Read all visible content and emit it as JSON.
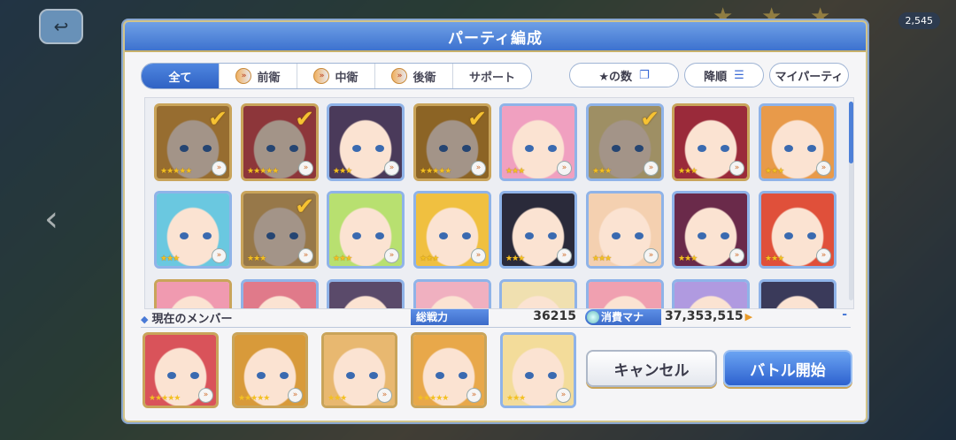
{
  "background": {
    "top_mana": "2,545",
    "back_icon": "back-arrow-icon"
  },
  "dialog": {
    "title": "パーティ編成"
  },
  "filter_tabs": [
    {
      "label": "全て",
      "active": true,
      "icon": false
    },
    {
      "label": "前衛",
      "active": false,
      "icon": true
    },
    {
      "label": "中衛",
      "active": false,
      "icon": true
    },
    {
      "label": "後衛",
      "active": false,
      "icon": true
    },
    {
      "label": "サポート",
      "active": false,
      "icon": false
    }
  ],
  "sort": {
    "star_label": "★の数",
    "order_label": "降順",
    "my_party_label": "マイパーティ"
  },
  "roster": [
    {
      "stars": "★★★★★",
      "selected": true,
      "frame": "gold",
      "hair": "#e8a84a"
    },
    {
      "stars": "★★★★★",
      "selected": true,
      "frame": "gold",
      "hair": "#d9535a"
    },
    {
      "stars": "★★★",
      "selected": false,
      "frame": "blue",
      "hair": "#4a3a5a"
    },
    {
      "stars": "★★★★★",
      "selected": true,
      "frame": "gold",
      "hair": "#d89a3a"
    },
    {
      "stars": "★★★",
      "selected": false,
      "frame": "blue",
      "hair": "#f0a0c0"
    },
    {
      "stars": "★★★",
      "selected": true,
      "frame": "blue",
      "hair": "#f3dc9a"
    },
    {
      "stars": "★★★",
      "selected": false,
      "frame": "gold",
      "hair": "#9a2a3a"
    },
    {
      "stars": "★★★",
      "selected": false,
      "frame": "blue",
      "hair": "#e89a4a"
    },
    {
      "stars": "★★★",
      "selected": false,
      "frame": "blue",
      "hair": "#6ac8e0"
    },
    {
      "stars": "★★★",
      "selected": true,
      "frame": "gold",
      "hair": "#e8b870"
    },
    {
      "stars": "★★★",
      "selected": false,
      "frame": "blue",
      "hair": "#b8e070"
    },
    {
      "stars": "★★★",
      "selected": false,
      "frame": "blue",
      "hair": "#f0c040"
    },
    {
      "stars": "★★★",
      "selected": false,
      "frame": "blue",
      "hair": "#2a2a3a"
    },
    {
      "stars": "★★★",
      "selected": false,
      "frame": "blue",
      "hair": "#f4d0b0"
    },
    {
      "stars": "★★★",
      "selected": false,
      "frame": "blue",
      "hair": "#6a2a4a"
    },
    {
      "stars": "★★★",
      "selected": false,
      "frame": "blue",
      "hair": "#e0503a"
    },
    {
      "stars": "",
      "selected": false,
      "frame": "gold",
      "hair": "#f09ab0"
    },
    {
      "stars": "",
      "selected": false,
      "frame": "blue",
      "hair": "#e07a8a"
    },
    {
      "stars": "",
      "selected": false,
      "frame": "blue",
      "hair": "#5a4a6a"
    },
    {
      "stars": "",
      "selected": false,
      "frame": "blue",
      "hair": "#f0b0c0"
    },
    {
      "stars": "",
      "selected": false,
      "frame": "blue",
      "hair": "#f0e0b0"
    },
    {
      "stars": "",
      "selected": false,
      "frame": "blue",
      "hair": "#f0a0b0"
    },
    {
      "stars": "",
      "selected": false,
      "frame": "blue",
      "hair": "#b09ae0"
    },
    {
      "stars": "",
      "selected": false,
      "frame": "blue",
      "hair": "#3a3a5a"
    }
  ],
  "party": {
    "members_label": "現在のメンバー",
    "power_label": "総戦力",
    "power_value": "36215",
    "mana_label": "消費マナ",
    "mana_value": "37,353,515",
    "members": [
      {
        "stars": "★★★★★",
        "hair": "#d9535a"
      },
      {
        "stars": "★★★★★",
        "hair": "#d89a3a"
      },
      {
        "stars": "★★★",
        "hair": "#e8b870"
      },
      {
        "stars": "★★★★★",
        "hair": "#e8a84a"
      },
      {
        "stars": "★★★",
        "hair": "#f3dc9a"
      }
    ]
  },
  "actions": {
    "cancel_label": "キャンセル",
    "start_label": "バトル開始"
  },
  "colors": {
    "accent": "#3d72cf",
    "gold_frame": "#c9a45a",
    "check": "#f6c232"
  }
}
